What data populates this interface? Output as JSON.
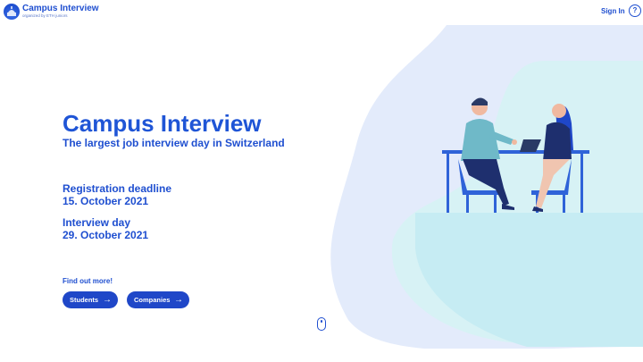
{
  "header": {
    "brand_title": "Campus Interview",
    "brand_subtitle": "organized by ETH juniors",
    "sign_in_label": "Sign In",
    "help_icon_glyph": "?"
  },
  "hero": {
    "title": "Campus Interview",
    "subtitle": "The largest job interview day in Switzerland",
    "registration_label": "Registration deadline",
    "registration_date": "15. October 2021",
    "interview_label": "Interview day",
    "interview_date": "29. October 2021",
    "find_out_more": "Find out more!",
    "students_button": "Students",
    "companies_button": "Companies",
    "button_arrow": "→"
  },
  "icons": [
    "logo-icon",
    "help-icon",
    "arrow-right-icon",
    "mouse-scroll-icon"
  ],
  "colors": {
    "primary": "#1f4fd0",
    "button": "#1f47c8",
    "blob_light": "#e3ebfb",
    "blob_teal": "#c9eef3"
  }
}
